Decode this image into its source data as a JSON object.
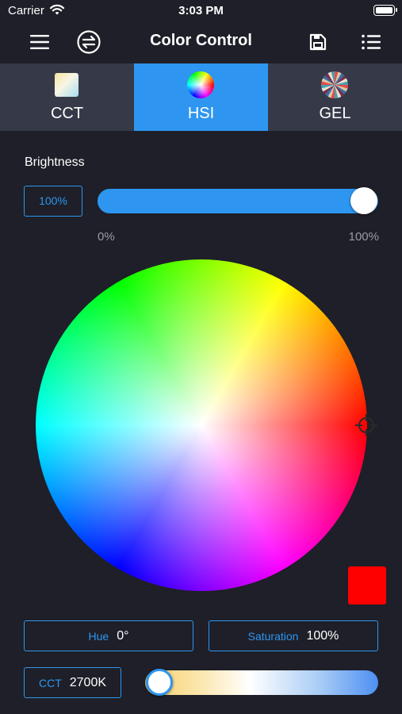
{
  "status_bar": {
    "carrier": "Carrier",
    "time": "3:03 PM"
  },
  "header": {
    "title": "Color Control",
    "icons": [
      "menu-icon",
      "swap-icon",
      "save-icon",
      "list-icon"
    ]
  },
  "tabs": [
    {
      "label": "CCT",
      "icon": "cct-gradient-icon",
      "active": false
    },
    {
      "label": "HSI",
      "icon": "color-wheel-icon",
      "active": true
    },
    {
      "label": "GEL",
      "icon": "gel-wheel-icon",
      "active": false
    }
  ],
  "brightness": {
    "label": "Brightness",
    "value_text": "100%",
    "value": 1.0,
    "min_label": "0%",
    "max_label": "100%"
  },
  "hsi": {
    "hue_label": "Hue",
    "hue_value": "0°",
    "saturation_label": "Saturation",
    "saturation_value": "100%",
    "selected_color": "#ff0000"
  },
  "cct": {
    "label": "CCT",
    "value": "2700K",
    "slider_position": 0.0
  },
  "colors": {
    "background": "#1e1f28",
    "accent": "#2e96f0",
    "tab_bar": "#363a48",
    "muted_text": "#9a9ca6"
  }
}
